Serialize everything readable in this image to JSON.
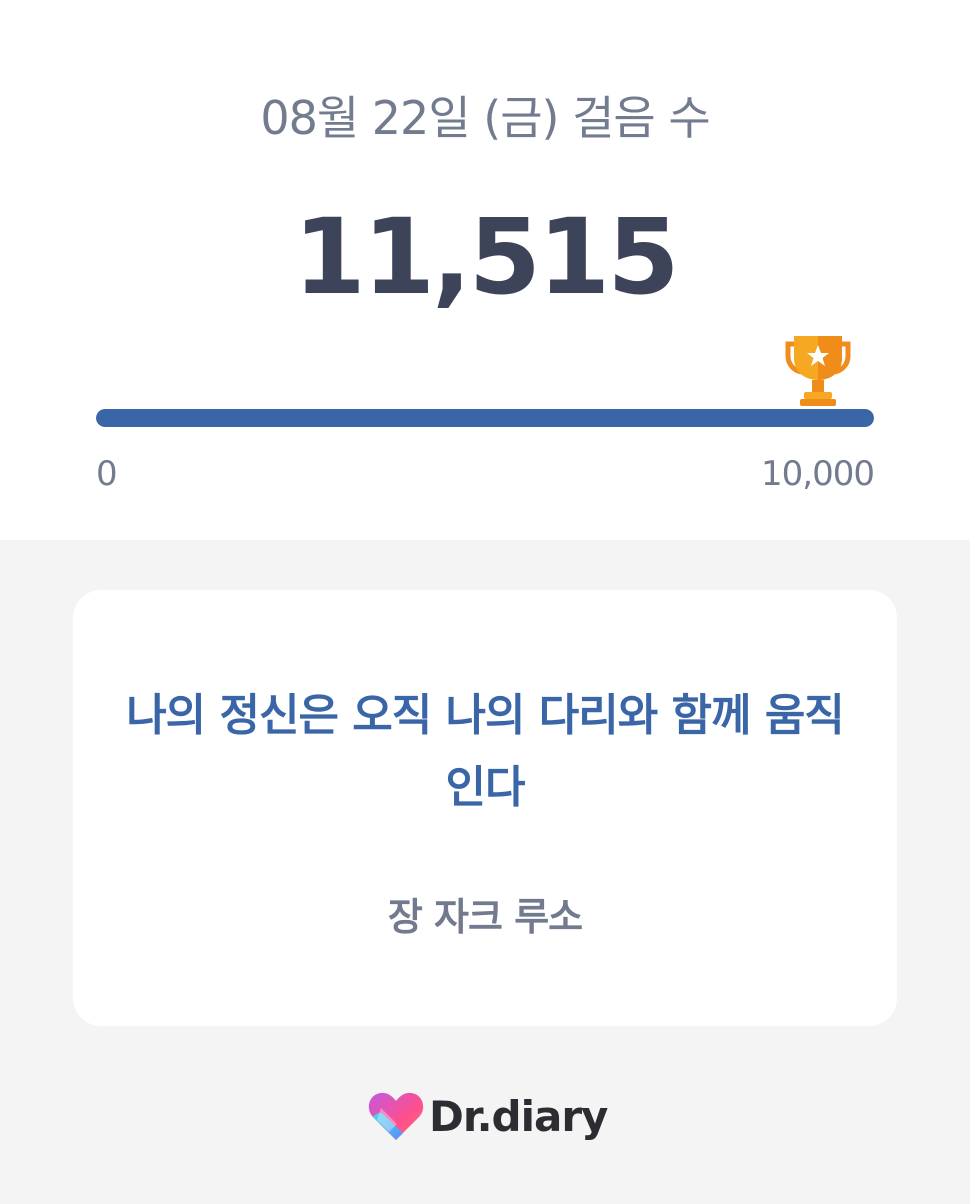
{
  "header": {
    "date_title": "08월 22일 (금) 걸음 수",
    "steps": "11,515"
  },
  "progress": {
    "min_label": "0",
    "max_label": "10,000",
    "steps_value": 11515,
    "goal_value": 10000,
    "fill_fraction": 1.0,
    "bar_color": "#3a66a8",
    "goal_icon": "trophy-icon"
  },
  "quote": {
    "text": "나의 정신은 오직 나의 다리와 함께 움직인다",
    "author": "장 자크 루소"
  },
  "brand": {
    "name": "Dr.diary",
    "logo_icon": "heart-logo-icon"
  },
  "colors": {
    "accent": "#3a66a8",
    "trophy": "#f5a020",
    "text_muted": "#737b8f",
    "text_strong": "#3d4459"
  }
}
